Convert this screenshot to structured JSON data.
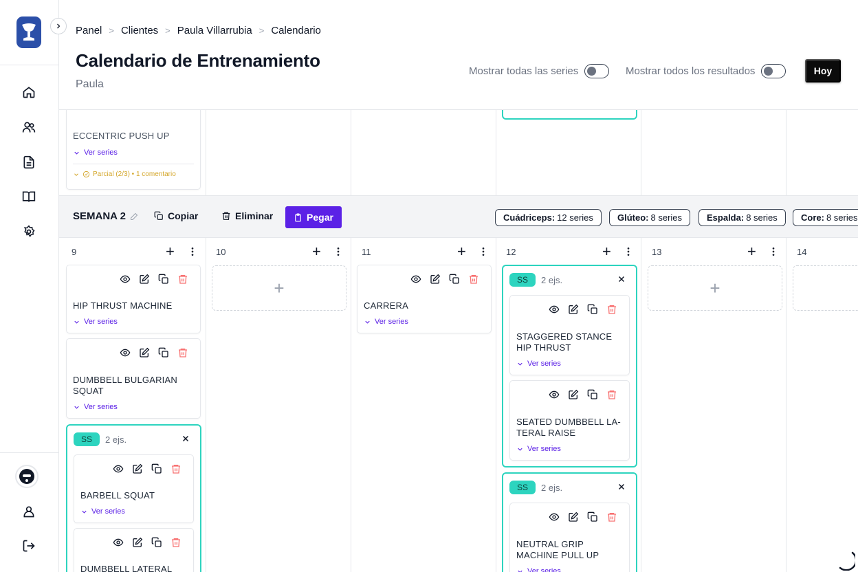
{
  "breadcrumb": [
    "Panel",
    "Clientes",
    "Paula Villarrubia",
    "Calendario"
  ],
  "page": {
    "title": "Calendario de Entrenamiento",
    "subtitle": "Paula"
  },
  "toggles": {
    "all_series": "Mostrar todas las series",
    "all_results": "Mostrar todos los resultados"
  },
  "today_label": "Hoy",
  "top_row": {
    "exercise": "ECCENTRIC PUSH UP",
    "ver_series": "Ver series",
    "partial": "Parcial (2/3) • 1 comentario"
  },
  "week": {
    "label": "SEMANA 2",
    "copy": "Copiar",
    "delete": "Eliminar",
    "paste": "Pegar",
    "muscles": [
      {
        "name": "Cuádriceps:",
        "value": "12 series"
      },
      {
        "name": "Glúteo:",
        "value": "8 series"
      },
      {
        "name": "Espalda:",
        "value": "8 series"
      },
      {
        "name": "Core:",
        "value": "8 series"
      }
    ]
  },
  "days": [
    "9",
    "10",
    "11",
    "12",
    "13",
    "14"
  ],
  "ver_series": "Ver series",
  "ss": {
    "badge": "SS",
    "count": "2 ejs."
  },
  "exercises": {
    "d9_1": "HIP THRUST MACHINE",
    "d9_2": "DUMBBELL BULGARIAN SQUAT",
    "d9_ss_1": "BARBELL SQUAT",
    "d9_ss_2": "DUMBBELL LATERAL",
    "d11_1": "CARRERA",
    "d12_ss1_1": "STAGGERED STANCE HIP THRUST",
    "d12_ss1_2": "SEATED DUMBBELL LA-TERAL RAISE",
    "d12_ss2_1": "NEUTRAL GRIP MACHINE PULL UP"
  },
  "colors": {
    "accent": "#5b21e6",
    "superset": "#2dd4bf",
    "delete": "#f87171",
    "partial": "#d4a72c"
  }
}
